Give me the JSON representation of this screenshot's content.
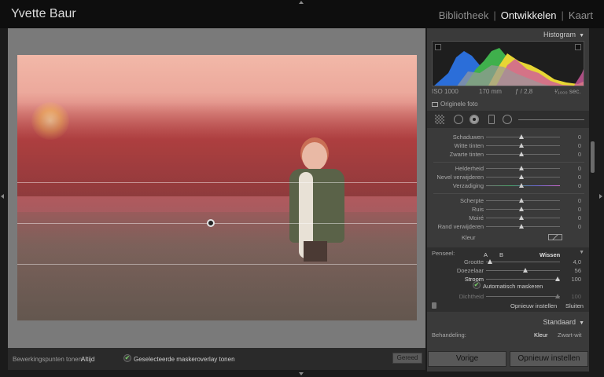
{
  "header": {
    "title": "Yvette Baur",
    "modules": [
      "Bibliotheek",
      "Ontwikkelen",
      "Kaart"
    ],
    "active_module": "Ontwikkelen"
  },
  "toolbar": {
    "edit_points_label": "Bewerkingspunten tonen:",
    "edit_points_value": "Altijd",
    "overlay_label": "Geselecteerde maskeroverlay tonen",
    "done_label": "Gereed"
  },
  "panel": {
    "histogram_title": "Histogram",
    "exif": {
      "iso": "ISO 1000",
      "focal": "170 mm",
      "aperture": "ƒ / 2,8",
      "shutter": "¹⁄₁₀₀₀ sec."
    },
    "original_photo": "Originele foto",
    "adjustments": [
      {
        "label": "Schaduwen",
        "value": "0"
      },
      {
        "label": "Witte tinten",
        "value": "0"
      },
      {
        "label": "Zwarte tinten",
        "value": "0"
      },
      {
        "label": "Helderheid",
        "value": "0"
      },
      {
        "label": "Nevel verwijderen",
        "value": "0"
      },
      {
        "label": "Verzadiging",
        "value": "0"
      },
      {
        "label": "Scherpte",
        "value": "0"
      },
      {
        "label": "Ruis",
        "value": "0"
      },
      {
        "label": "Moiré",
        "value": "0"
      },
      {
        "label": "Rand verwijderen",
        "value": "0"
      }
    ],
    "color_label": "Kleur",
    "brush": {
      "label": "Penseel:",
      "a": "A",
      "b": "B",
      "erase": "Wissen",
      "size_label": "Grootte",
      "size_value": "4,0",
      "feather_label": "Doezelaar",
      "feather_value": "56",
      "flow_label": "Stroom",
      "flow_value": "100",
      "auto_mask": "Automatisch maskeren",
      "density_label": "Dichtheid",
      "density_value": "100"
    },
    "reset_label": "Opnieuw instellen",
    "close_label": "Sluiten",
    "basic_title": "Standaard",
    "treatment_label": "Behandeling:",
    "treatment_color": "Kleur",
    "treatment_bw": "Zwart-wit"
  },
  "bottom_buttons": {
    "previous": "Vorige",
    "reset": "Opnieuw instellen"
  }
}
